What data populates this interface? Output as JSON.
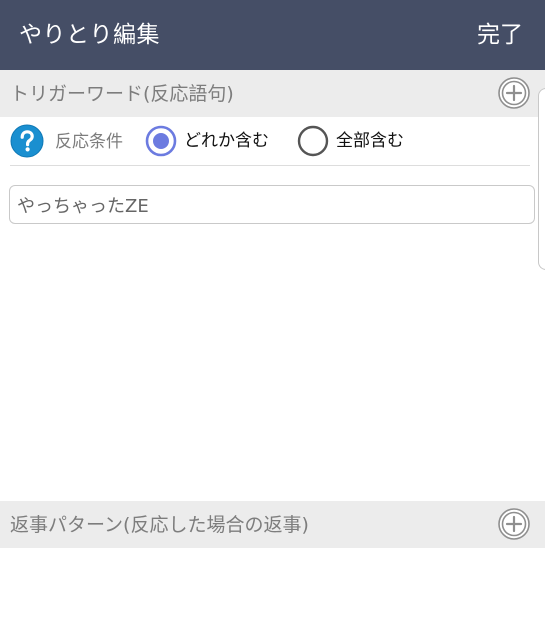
{
  "app_bar": {
    "title": "やりとり編集",
    "done_label": "完了",
    "background_color": "#454e66"
  },
  "trigger_section": {
    "title": "トリガーワード(反応語句)",
    "add_icon": "plus-circle-icon"
  },
  "condition": {
    "help_icon": "question-circle-icon",
    "label": "反応条件",
    "options": [
      {
        "label": "どれか含む",
        "selected": true
      },
      {
        "label": "全部含む",
        "selected": false
      }
    ],
    "accent_color": "#6c7be0"
  },
  "trigger_input": {
    "value": "やっちゃったZE"
  },
  "reply_section": {
    "title": "返事パターン(反応した場合の返事)",
    "add_icon": "plus-circle-icon"
  }
}
